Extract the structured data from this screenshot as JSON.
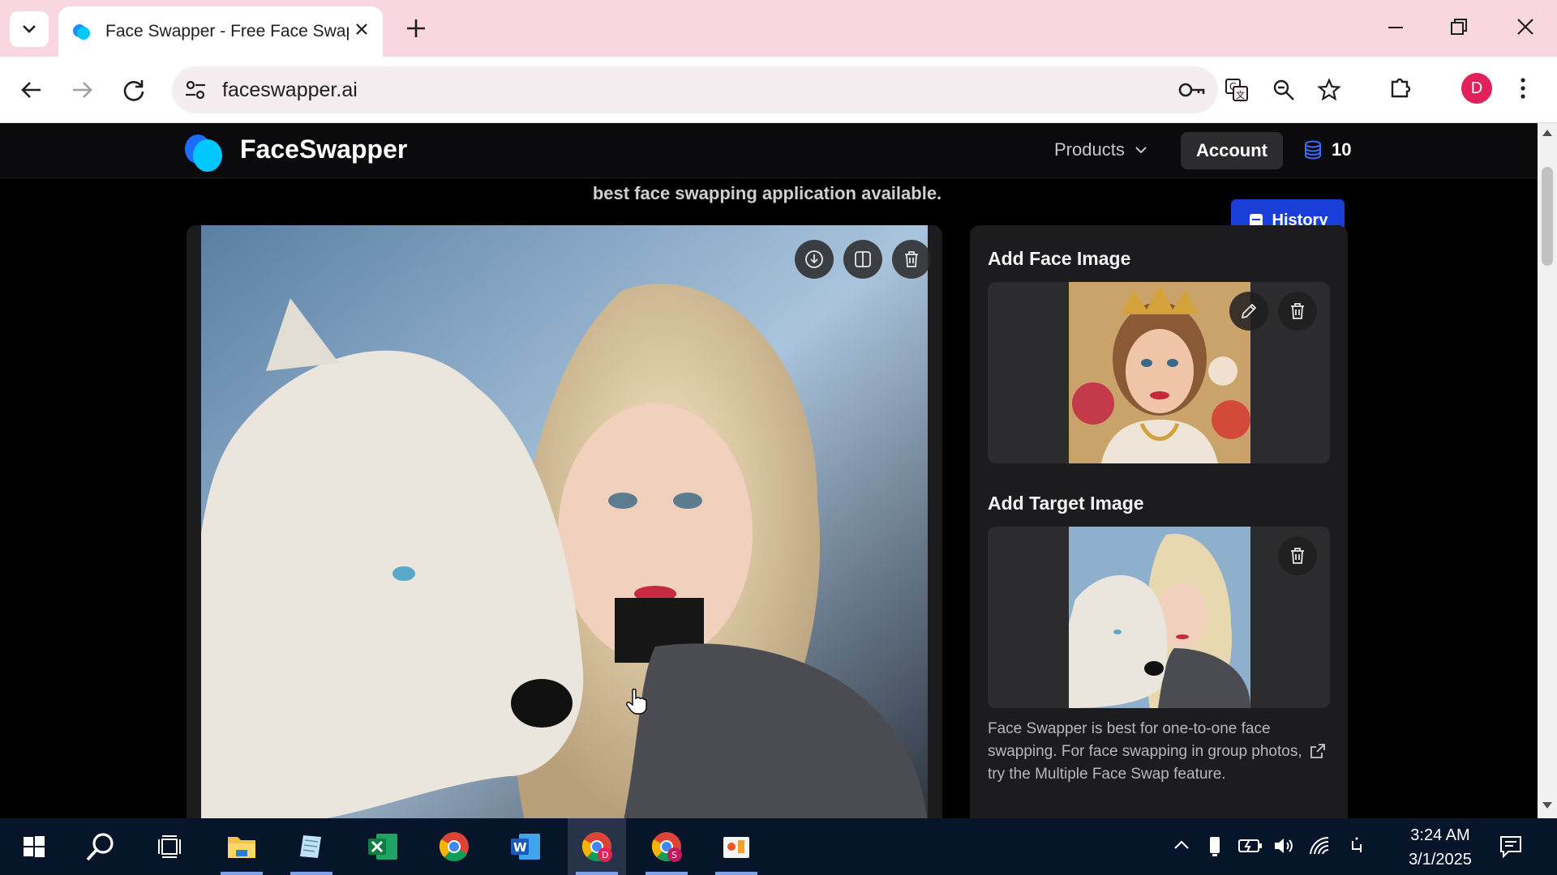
{
  "browser": {
    "tab_title": "Face Swapper - Free Face Swap",
    "url": "faceswapper.ai",
    "profile_initial": "D"
  },
  "site": {
    "brand": "FaceSwapper",
    "nav": {
      "products_label": "Products",
      "account_label": "Account",
      "credits": "10"
    },
    "tagline": "best face swapping application available.",
    "history_label": "History"
  },
  "panel": {
    "face_title": "Add Face Image",
    "target_title": "Add Target Image",
    "tip": "Face Swapper is best for one-to-one face swapping. For face swapping in group photos, try the Multiple Face Swap feature."
  },
  "taskbar": {
    "time": "3:24 AM",
    "date": "3/1/2025",
    "apps": [
      "start-icon",
      "search-icon",
      "task-view-icon",
      "file-explorer-icon",
      "notepad-icon",
      "excel-icon",
      "chrome-icon",
      "word-icon",
      "chrome-profile-d-icon",
      "chrome-profile-s-icon",
      "paint-icon"
    ]
  },
  "colors": {
    "tab_bar": "#f8d7e1",
    "accent_blue": "#1a3fd8",
    "page_bg": "#000000",
    "panel_bg": "#1c1c1e"
  }
}
